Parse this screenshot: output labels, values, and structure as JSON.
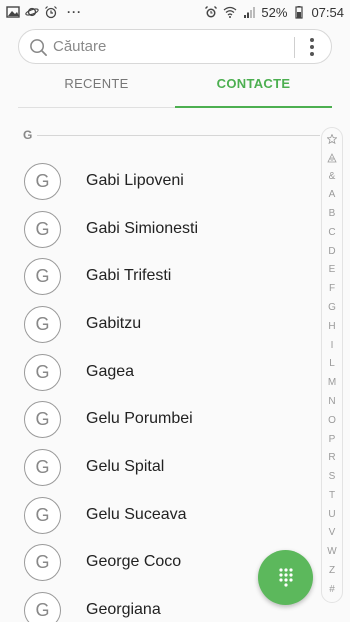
{
  "status_bar": {
    "left_icons": [
      "gallery-icon",
      "saturn-icon",
      "alarm-clock-icon",
      "more-dots-icon"
    ],
    "battery_percent": "52%",
    "time": "07:54"
  },
  "search": {
    "placeholder": "Căutare"
  },
  "tabs": [
    {
      "label": "RECENTE",
      "selected": false
    },
    {
      "label": "CONTACTE",
      "selected": true
    }
  ],
  "accent_color": "#4caf50",
  "section": {
    "letter": "G"
  },
  "contacts": [
    {
      "initial": "G",
      "name": "Gabi Lipoveni"
    },
    {
      "initial": "G",
      "name": "Gabi Simionesti"
    },
    {
      "initial": "G",
      "name": "Gabi Trifesti"
    },
    {
      "initial": "G",
      "name": "Gabitzu"
    },
    {
      "initial": "G",
      "name": "Gagea"
    },
    {
      "initial": "G",
      "name": "Gelu Porumbei"
    },
    {
      "initial": "G",
      "name": "Gelu Spital"
    },
    {
      "initial": "G",
      "name": "Gelu Suceava"
    },
    {
      "initial": "G",
      "name": "George Coco"
    },
    {
      "initial": "G",
      "name": "Georgiana"
    }
  ],
  "index_letters": [
    "&",
    "A",
    "B",
    "C",
    "D",
    "E",
    "F",
    "G",
    "H",
    "I",
    "L",
    "M",
    "N",
    "O",
    "P",
    "R",
    "S",
    "T",
    "U",
    "V",
    "W",
    "Z",
    "#"
  ],
  "fab": {
    "icon": "dialpad-icon"
  }
}
